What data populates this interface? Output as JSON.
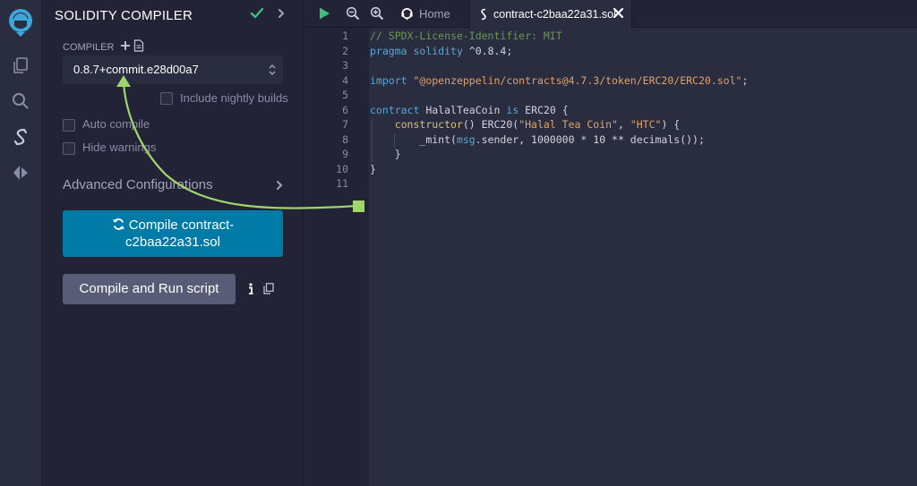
{
  "panel": {
    "title": "SOLIDITY COMPILER",
    "compiler_label": "COMPILER",
    "compiler_version": "0.8.7+commit.e28d00a7",
    "include_nightly_label": "Include nightly builds",
    "auto_compile_label": "Auto compile",
    "hide_warnings_label": "Hide warnings",
    "advanced_label": "Advanced Configurations",
    "compile_button_line1": "Compile contract-",
    "compile_button_line2": "c2baa22a31.sol",
    "run_script_label": "Compile and Run script"
  },
  "tabs": {
    "home_label": "Home",
    "file_label": "contract-c2baa22a31.sol"
  },
  "editor": {
    "line_numbers": [
      "1",
      "2",
      "3",
      "4",
      "5",
      "6",
      "7",
      "8",
      "9",
      "10",
      "11"
    ],
    "lines": [
      "// SPDX-License-Identifier: MIT",
      "pragma solidity ^0.8.4;",
      "",
      "import \"@openzeppelin/contracts@4.7.3/token/ERC20/ERC20.sol\";",
      "",
      "contract HalalTeaCoin is ERC20 {",
      "    constructor() ERC20(\"Halal Tea Coin\", \"HTC\") {",
      "        _mint(msg.sender, 1000000 * 10 ** decimals());",
      "    }",
      "}",
      ""
    ]
  },
  "icons": {
    "rail": [
      "remix-logo-icon",
      "file-explorer-icon",
      "search-icon",
      "solidity-compiler-icon",
      "deploy-ethereum-icon"
    ],
    "header": [
      "check-icon",
      "chevron-right-icon"
    ]
  },
  "colors": {
    "accent_blue": "#007aa6",
    "success_green": "#3fbf7a",
    "annotation_green": "#9fd66b",
    "panel_bg": "#222336",
    "editor_bg": "#2a2c3f"
  }
}
